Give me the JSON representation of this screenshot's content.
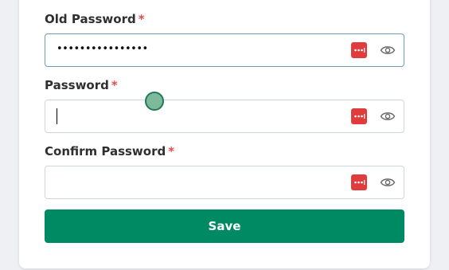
{
  "form": {
    "old_password": {
      "label": "Old Password",
      "required_mark": "*",
      "value": "••••••••••••••••"
    },
    "password": {
      "label": "Password",
      "required_mark": "*",
      "value": ""
    },
    "confirm_password": {
      "label": "Confirm Password",
      "required_mark": "*",
      "value": ""
    },
    "save_label": "Save"
  },
  "icons": {
    "password_manager": "password-manager-icon",
    "show_password": "eye-icon"
  },
  "colors": {
    "primary": "#008a63",
    "required": "#e04f4f",
    "password_manager": "#e03c3c",
    "focus_border": "#6a9bb8"
  }
}
